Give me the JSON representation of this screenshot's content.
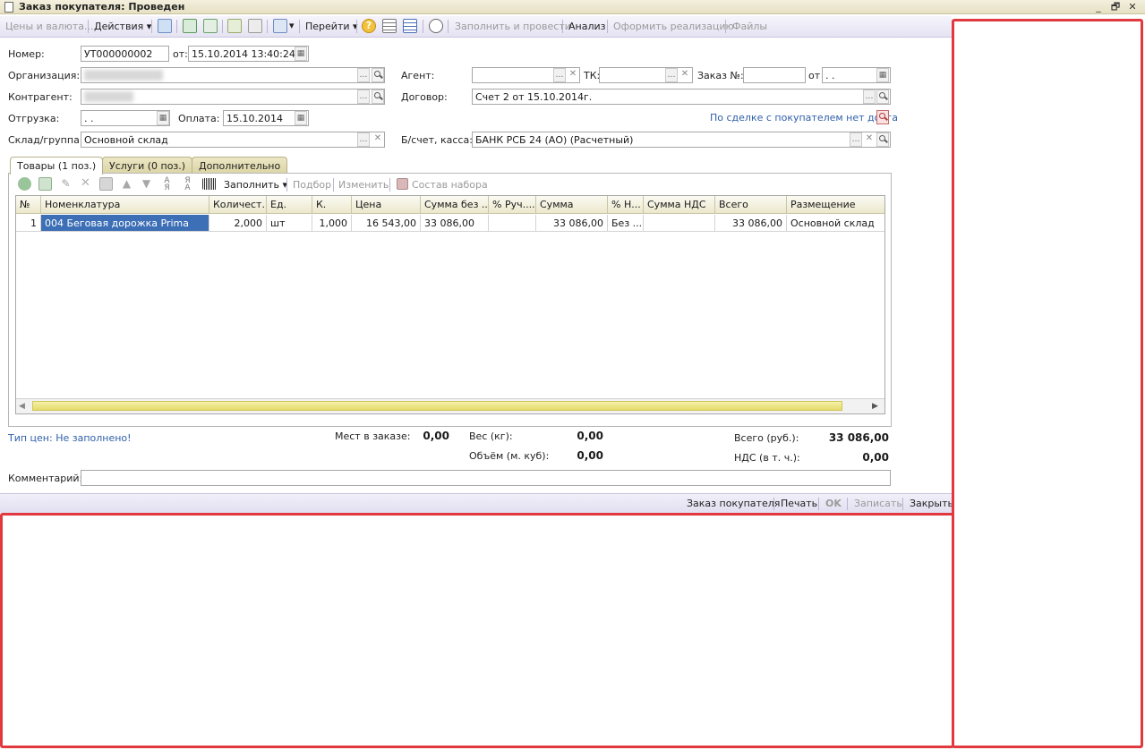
{
  "window": {
    "title": "Заказ покупателя: Проведен",
    "controls": [
      "_",
      "🗗",
      "✕"
    ]
  },
  "toolbar": {
    "prices_currency": "Цены и валюта...",
    "actions": "Действия",
    "goto": "Перейти",
    "fill_and_post": "Заполнить и провести",
    "analysis": "Анализ",
    "make_realization": "Оформить реализацию",
    "files": "Файлы"
  },
  "header": {
    "number_label": "Номер:",
    "number_value": "УТ000000002",
    "from_label": "от:",
    "date_value": "15.10.2014 13:40:24",
    "organization_label": "Организация:",
    "counterparty_label": "Контрагент:",
    "shipment_label": "Отгрузка:",
    "shipment_value": " .  .",
    "payment_label": "Оплата:",
    "payment_value": "15.10.2014",
    "warehouse_label": "Склад/группа:",
    "warehouse_value": "Основной склад",
    "agent_label": "Агент:",
    "tk_label": "ТК:",
    "order_no_label": "Заказ №:",
    "order_from_label": "от",
    "order_from_value": " .  .",
    "contract_label": "Договор:",
    "contract_value": "Счет 2 от 15.10.2014г.",
    "debt_link": "По сделке с покупателем нет долга",
    "bank_label": "Б/счет, касса:",
    "bank_value": "БАНК РСБ 24 (АО) (Расчетный)"
  },
  "tabs": [
    {
      "label": "Товары (1 поз.)"
    },
    {
      "label": "Услуги (0 поз.)"
    },
    {
      "label": "Дополнительно"
    }
  ],
  "table_toolbar": {
    "fill": "Заполнить",
    "selection": "Подбор",
    "change": "Изменить",
    "bundle": "Состав набора"
  },
  "table": {
    "headers": [
      "№",
      "Номенклатура",
      "Количест...",
      "Ед.",
      "К.",
      "Цена",
      "Сумма без ...",
      "% Руч....",
      "Сумма",
      "% Н...",
      "Сумма НДС",
      "Всего",
      "Размещение"
    ],
    "rows": [
      [
        "1",
        "004 Беговая дорожка Prima",
        "2,000",
        "шт",
        "1,000",
        "16 543,00",
        "33 086,00",
        "",
        "33 086,00",
        "Без ...",
        "",
        "33 086,00",
        "Основной склад"
      ]
    ]
  },
  "footer": {
    "price_type": "Тип цен: Не заполнено!",
    "places_label": "Мест в заказе:",
    "places_value": "0,00",
    "weight_label": "Вес (кг):",
    "weight_value": "0,00",
    "volume_label": "Объём (м. куб):",
    "volume_value": "0,00",
    "total_label": "Всего (руб.):",
    "total_value": "33 086,00",
    "vat_label": "НДС (в т. ч.):",
    "vat_value": "0,00",
    "comment_label": "Комментарий:",
    "comment_value": ""
  },
  "bottom_bar": {
    "customer_order": "Заказ покупателя",
    "print": "Печать",
    "ok": "OK",
    "save": "Записать",
    "close": "Закрыть"
  },
  "colors": {
    "highlight_border": "#e0393f",
    "selection": "#3d6fb6",
    "link": "#2f5fa8"
  }
}
